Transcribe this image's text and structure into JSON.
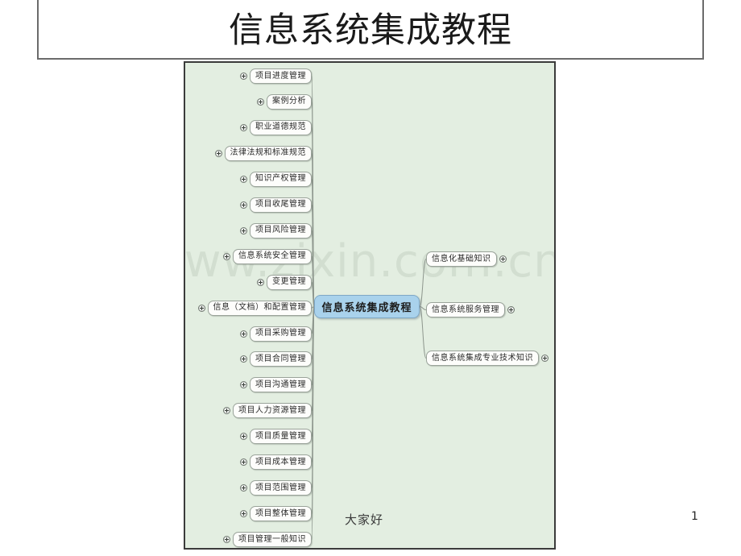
{
  "slide": {
    "title": "信息系统集成教程",
    "footer_text": "大家好",
    "page_number": "1",
    "watermark": "www.zixin.com.cn"
  },
  "mindmap": {
    "center": {
      "label": "信息系统集成教程",
      "fill_color": "#a9d2ec",
      "border_color": "#7fa8c6"
    },
    "panel": {
      "background_color": "#e3eee1",
      "border_color": "#3b3b3b"
    },
    "node_style": {
      "fill_color": "#fdfdfb",
      "border_color": "#9aa39a",
      "text_color": "#2a2a2a",
      "expander_icon": "plus-circle-icon"
    },
    "left_branches": [
      {
        "label": "项目进度管理"
      },
      {
        "label": "案例分析"
      },
      {
        "label": "职业道德规范"
      },
      {
        "label": "法律法规和标准规范"
      },
      {
        "label": "知识产权管理"
      },
      {
        "label": "项目收尾管理"
      },
      {
        "label": "项目风险管理"
      },
      {
        "label": "信息系统安全管理"
      },
      {
        "label": "变更管理"
      },
      {
        "label": "信息（文档）和配置管理"
      },
      {
        "label": "项目采购管理"
      },
      {
        "label": "项目合同管理"
      },
      {
        "label": "项目沟通管理"
      },
      {
        "label": "项目人力资源管理"
      },
      {
        "label": "项目质量管理"
      },
      {
        "label": "项目成本管理"
      },
      {
        "label": "项目范围管理"
      },
      {
        "label": "项目整体管理"
      },
      {
        "label": "项目管理一般知识"
      }
    ],
    "right_branches": [
      {
        "label": "信息化基础知识"
      },
      {
        "label": "信息系统服务管理"
      },
      {
        "label": "信息系统集成专业技术知识"
      }
    ]
  }
}
